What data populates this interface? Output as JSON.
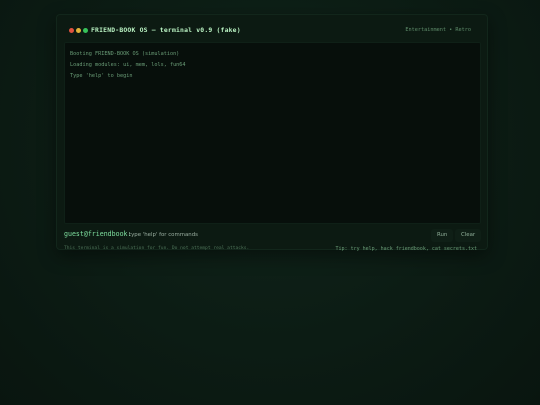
{
  "window": {
    "title": "FRIEND-BOOK OS — terminal v0.9 (fake)",
    "badge": "Entertainment • Retro"
  },
  "terminal": {
    "lines": [
      "Booting FRIEND-BOOK OS (simulation)",
      "Loading modules: ui, mem, lols, fun64",
      "Type 'help' to begin"
    ]
  },
  "command": {
    "prompt": "guest@friendbook:",
    "placeholder": "type 'help' for commands",
    "value": "",
    "run_label": "Run",
    "clear_label": "Clear"
  },
  "footer": {
    "disclaimer": "This terminal is a simulation for fun. Do not attempt real attacks.",
    "tip": "Tip: try help, hack friendbook, cat secrets.txt"
  },
  "colors": {
    "background": "#0b1a12",
    "accent": "#7fe0a0",
    "close": "#e0533f",
    "minimize": "#e2b33a",
    "maximize": "#37c25a"
  }
}
